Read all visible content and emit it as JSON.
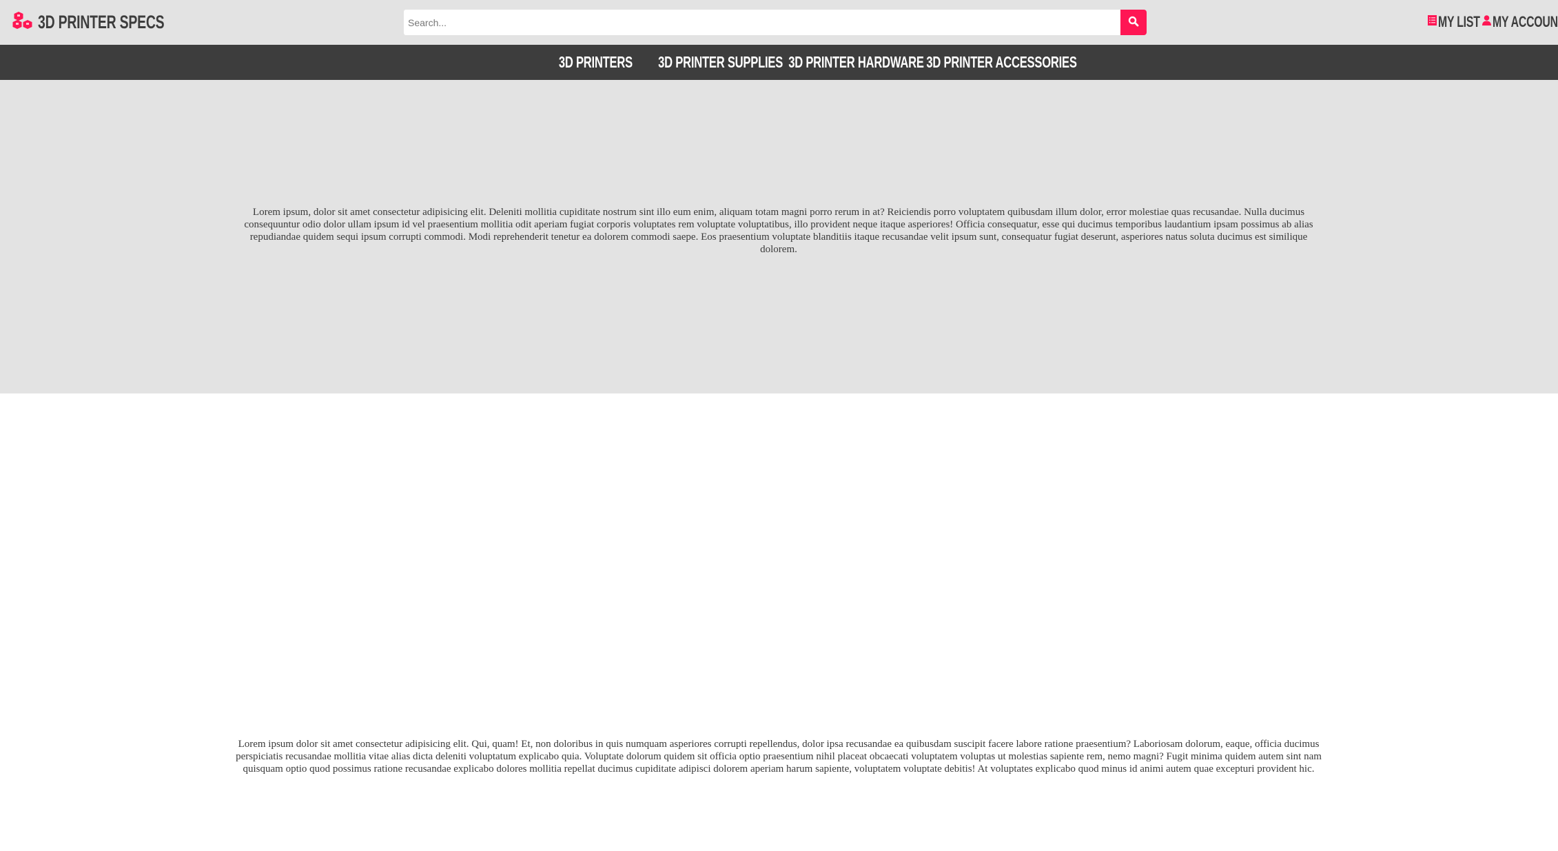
{
  "header": {
    "logo_text": "3D PRINTER SPECS",
    "search": {
      "placeholder": "Search...",
      "value": ""
    },
    "my_list_label": "MY LIST",
    "my_account_label": "MY ACCOUNT"
  },
  "colors": {
    "accent": "#ff1654",
    "nav_bg": "#3d3d3d",
    "header_bg": "#e3e3e3"
  },
  "icons": {
    "logo": "cubes-icon",
    "search": "search-icon",
    "list": "list-icon",
    "account": "user-icon"
  },
  "nav": {
    "items": [
      {
        "label": "3D PRINTERS"
      },
      {
        "label": "3D PRINTER SUPPLIES"
      },
      {
        "label": "3D PRINTER HARDWARE"
      },
      {
        "label": "3D PRINTER ACCESSORIES"
      }
    ]
  },
  "main": {
    "hero_text": "Lorem ipsum, dolor sit amet consectetur adipisicing elit. Deleniti mollitia cupiditate nostrum sint illo eum enim, aliquam totam magni porro rerum in at? Reiciendis porro voluptatem quibusdam illum dolor, error molestiae quas recusandae. Nulla ducimus consequuntur odio dolor ullam ipsum id vel praesentium mollitia odit aperiam fugiat corporis voluptates rem voluptate voluptatibus, illo provident neque itaque asperiores! Officia consequatur, esse qui ducimus temporibus laudantium ipsam possimus ab alias repudiandae quidem sequi ipsum corrupti commodi. Modi reprehenderit tenetur ea dolorem commodi saepe. Eos praesentium voluptate blanditiis itaque recusandae velit ipsum sunt, consequatur fugiat deserunt, asperiores natus soluta ducimus est similique dolorem.",
    "body_text": "Lorem ipsum dolor sit amet consectetur adipisicing elit. Qui, quam! Et, non doloribus in quis numquam asperiores corrupti repellendus, dolor ipsa recusandae ea quibusdam suscipit facere labore ratione praesentium? Laboriosam dolorum, eaque, officia ducimus perspiciatis recusandae mollitia vitae alias dicta deleniti voluptatum explicabo quia. Voluptate dolorum quidem sit officia optio praesentium nihil placeat obcaecati voluptatem voluptas ut molestias sapiente rem, nemo magni? Fugit minima quidem autem sint nam quisquam optio quod possimus ratione recusandae explicabo dolores mollitia repellat ducimus cupiditate adipisci dolorem aperiam harum sapiente, voluptatem voluptate debitis! At voluptates explicabo quod minus id animi autem quae excepturi provident hic."
  }
}
